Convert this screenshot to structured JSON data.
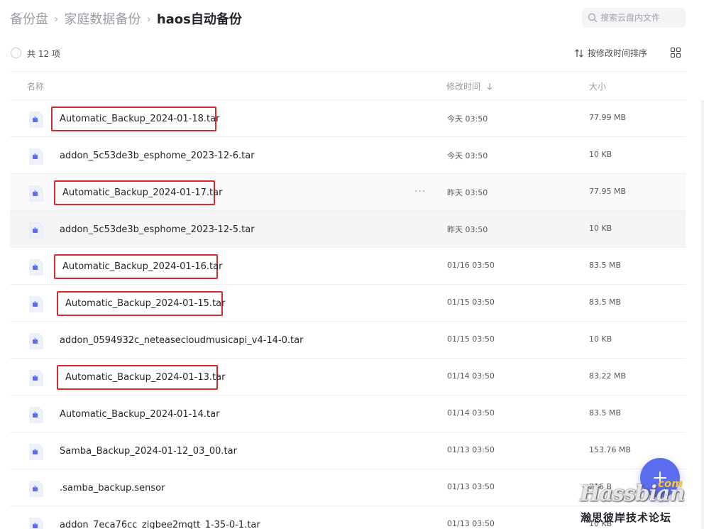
{
  "breadcrumb": {
    "root": "备份盘",
    "parent": "家庭数据备份",
    "current": "haos自动备份"
  },
  "search": {
    "placeholder": "搜索云盘内文件"
  },
  "toolbar": {
    "count_label": "共 12 项",
    "sort_label": "按修改时间排序"
  },
  "table": {
    "columns": {
      "name": "名称",
      "modified": "修改时间",
      "size": "大小"
    },
    "rows": [
      {
        "name": "Automatic_Backup_2024-01-18.tar",
        "modified": "今天 03:50",
        "size": "77.99 MB"
      },
      {
        "name": "addon_5c53de3b_esphome_2023-12-6.tar",
        "modified": "今天 03:50",
        "size": "10 KB"
      },
      {
        "name": "Automatic_Backup_2024-01-17.tar",
        "modified": "昨天 03:50",
        "size": "77.95 MB"
      },
      {
        "name": "addon_5c53de3b_esphome_2023-12-5.tar",
        "modified": "昨天 03:50",
        "size": "10 KB"
      },
      {
        "name": "Automatic_Backup_2024-01-16.tar",
        "modified": "01/16 03:50",
        "size": "83.5 MB"
      },
      {
        "name": "Automatic_Backup_2024-01-15.tar",
        "modified": "01/15 03:50",
        "size": "83.5 MB"
      },
      {
        "name": "addon_0594932c_neteasecloudmusicapi_v4-14-0.tar",
        "modified": "01/15 03:50",
        "size": "10 KB"
      },
      {
        "name": "Automatic_Backup_2024-01-13.tar",
        "modified": "01/14 03:50",
        "size": "83.22 MB"
      },
      {
        "name": "Automatic_Backup_2024-01-14.tar",
        "modified": "01/14 03:50",
        "size": "83.5 MB"
      },
      {
        "name": "Samba_Backup_2024-01-12_03_00.tar",
        "modified": "01/13 03:50",
        "size": "153.76 MB"
      },
      {
        "name": ".samba_backup.sensor",
        "modified": "01/13 03:50",
        "size": "216 B"
      },
      {
        "name": "addon_7eca76cc_zigbee2mqtt_1-35-0-1.tar",
        "modified": "01/13 03:50",
        "size": "10 KB"
      }
    ],
    "more_glyph": "···"
  },
  "watermark": {
    "logo": "Hassbian",
    "suffix": "com",
    "text": "瀚思彼岸技术论坛"
  },
  "icons": {
    "search": "search-icon",
    "sort": "sort-arrows-icon",
    "grid": "grid-view-icon",
    "sort_desc": "arrow-down-icon",
    "file": "archive-file-icon",
    "fab": "plus-icon"
  },
  "colors": {
    "accent": "#5b6dee",
    "highlight_border": "#d62b2b",
    "text_primary": "#25262b",
    "text_muted": "#9a9ba3"
  }
}
